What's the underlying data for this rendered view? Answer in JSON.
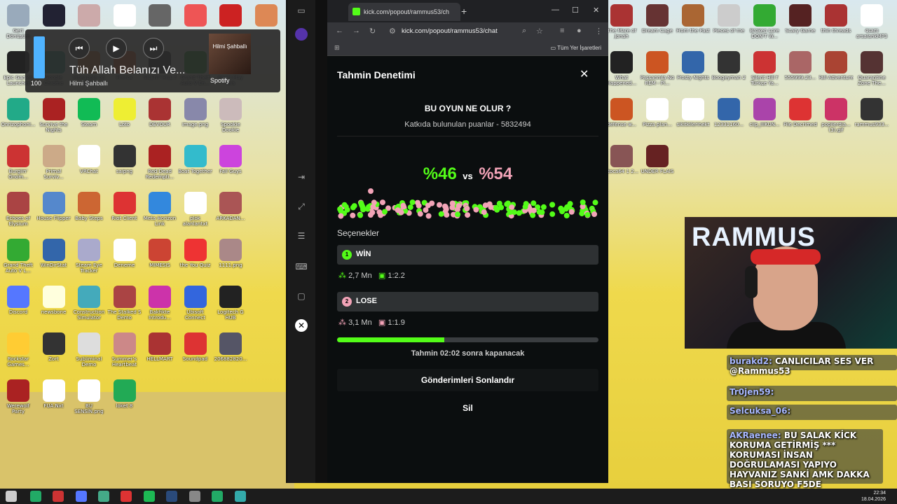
{
  "desktop": {
    "icons_left": [
      {
        "label": "Geri Dönüşüm",
        "color": "#9ab"
      },
      {
        "label": "",
        "color": "#223"
      },
      {
        "label": "",
        "color": "#caa"
      },
      {
        "label": "",
        "color": "#fff"
      },
      {
        "label": "",
        "color": "#666"
      },
      {
        "label": "",
        "color": "#e55"
      },
      {
        "label": "",
        "color": "#c22"
      },
      {
        "label": "",
        "color": "#d85"
      },
      {
        "label": "Epic Games Launcher",
        "color": "#222"
      },
      {
        "label": "Google Chrome",
        "color": "#4a8"
      },
      {
        "label": "Pineapple on pizza",
        "color": "#e84"
      },
      {
        "label": "Firefox",
        "color": "#f73"
      },
      {
        "label": "SILENT HILL f",
        "color": "#444"
      },
      {
        "label": "Grand Theft Auto V En...",
        "color": "#3a3"
      },
      {
        "label": "Don't Play this",
        "color": "#a63"
      },
      {
        "label": "Onrizophoni...",
        "color": "#2a8"
      },
      {
        "label": "Survive the Nights",
        "color": "#a22"
      },
      {
        "label": "Steam",
        "color": "#1b5"
      },
      {
        "label": "Loto",
        "color": "#ee3"
      },
      {
        "label": "DEVOUR",
        "color": "#a33"
      },
      {
        "label": "image.png",
        "color": "#88a"
      },
      {
        "label": "Spookie Dookie",
        "color": "#cbb"
      },
      {
        "label": "Burglin' Gnom...",
        "color": "#c33"
      },
      {
        "label": "Primal Surviv...",
        "color": "#ca8"
      },
      {
        "label": "VRChat",
        "color": "#fff"
      },
      {
        "label": "saipng",
        "color": "#333"
      },
      {
        "label": "Red Dead Redempti...",
        "color": "#a22"
      },
      {
        "label": "Boat Together",
        "color": "#3bc"
      },
      {
        "label": "Fall Guys",
        "color": "#c4d"
      },
      {
        "label": "Echoes of Elysium",
        "color": "#a44"
      },
      {
        "label": "House Flipper",
        "color": "#58c"
      },
      {
        "label": "Baby Steps",
        "color": "#c63"
      },
      {
        "label": "Riot Client",
        "color": "#d33"
      },
      {
        "label": "Meta Horizon Link",
        "color": "#38d"
      },
      {
        "label": "plok alanlarıtxt",
        "color": "#fff"
      },
      {
        "label": "ARKADAN...",
        "color": "#a55"
      },
      {
        "label": "Grand Theft Auto V L...",
        "color": "#3a3"
      },
      {
        "label": "WinDirStat",
        "color": "#36a"
      },
      {
        "label": "Steam Eye Tracker",
        "color": "#aac"
      },
      {
        "label": "Deneme",
        "color": "#fff"
      },
      {
        "label": "MIMESIS",
        "color": "#c43"
      },
      {
        "label": "the You Quiz",
        "color": "#e33"
      },
      {
        "label": "1111.png",
        "color": "#a88"
      },
      {
        "label": "Discord",
        "color": "#57f"
      },
      {
        "label": "newsbone",
        "color": "#ffd"
      },
      {
        "label": "Construction Simulator",
        "color": "#4ab"
      },
      {
        "label": "The Stalked S Demo",
        "color": "#a44"
      },
      {
        "label": "Bakfikte Introdu...",
        "color": "#c3a"
      },
      {
        "label": "Ubisoft Connect",
        "color": "#36d"
      },
      {
        "label": "Logitech G HUB",
        "color": "#222"
      },
      {
        "label": "Rockstar Games...",
        "color": "#fc3"
      },
      {
        "label": "Zort",
        "color": "#333"
      },
      {
        "label": "Subliminal Demo",
        "color": "#ddd"
      },
      {
        "label": "Summer's Heartbeat",
        "color": "#c88"
      },
      {
        "label": "HELLMART",
        "color": "#a33"
      },
      {
        "label": "Soundpad",
        "color": "#d33"
      },
      {
        "label": "206882820...",
        "color": "#556"
      },
      {
        "label": "Werewolf Party",
        "color": "#a22"
      },
      {
        "label": "FUA.Nxt",
        "color": "#fff"
      },
      {
        "label": "BU SENSİN.png",
        "color": "#fff"
      },
      {
        "label": "loket 8",
        "color": "#2a5"
      }
    ],
    "icons_right": [
      {
        "label": "The Mare of Jonah",
        "color": "#a33"
      },
      {
        "label": "Dream Cage",
        "color": "#633"
      },
      {
        "label": "From the Past",
        "color": "#a63"
      },
      {
        "label": "Pieces of me",
        "color": "#ccc"
      },
      {
        "label": "Broken Lore DON'T W...",
        "color": "#3a3"
      },
      {
        "label": "Scary Game",
        "color": "#522"
      },
      {
        "label": "thin threads",
        "color": "#a33"
      },
      {
        "label": "4sam arsalankMP3",
        "color": "#fff"
      },
      {
        "label": "What Happened...",
        "color": "#222"
      },
      {
        "label": "Passannıla No REM - Pl...",
        "color": "#c52"
      },
      {
        "label": "Frosty Nights",
        "color": "#36a"
      },
      {
        "label": "Boogeyman 2",
        "color": "#333"
      },
      {
        "label": "Silent Hill f Türkçe Ya...",
        "color": "#c33"
      },
      {
        "label": "555999.23...",
        "color": "#a66"
      },
      {
        "label": "Fall Adventure",
        "color": "#a43"
      },
      {
        "label": "Quarantine Zone The...",
        "color": "#533"
      },
      {
        "label": "defense w...",
        "color": "#c52"
      },
      {
        "label": "Pizza plan...",
        "color": "#fff"
      },
      {
        "label": "sikitkilerinekt",
        "color": "#fff"
      },
      {
        "label": "12331160...",
        "color": "#36a"
      },
      {
        "label": "clip_IIIKUN...",
        "color": "#a4a"
      },
      {
        "label": "File Decrimed",
        "color": "#d33"
      },
      {
        "label": "popilerdia... (3).gif",
        "color": "#c36"
      },
      {
        "label": "rammus933...",
        "color": "#333"
      },
      {
        "label": "Stoca64 1 2...",
        "color": "#855"
      },
      {
        "label": "UNDER FLAIS",
        "color": "#622"
      }
    ]
  },
  "media": {
    "volume": 100,
    "volume_label": "100",
    "title": "Tüh Allah Belanızı Ve...",
    "artist": "Hilmi Şahballı",
    "album_text": "Hilmi Şahballı",
    "source": "Spotify",
    "prev_icon": "skip-previous-icon",
    "play_icon": "play-icon",
    "next_icon": "skip-next-icon"
  },
  "browser": {
    "tab_title": "kick.com/popout/rammus53/ch",
    "url": "kick.com/popout/rammus53/chat",
    "bookmarks_label": "Tüm Yer İşaretleri"
  },
  "prediction": {
    "title": "Tahmin Denetimi",
    "question": "BU OYUN NE OLUR ?",
    "contributed": "Katkıda bulunulan puanlar - 5832494",
    "percent_a": "%46",
    "vs": "vs",
    "percent_b": "%54",
    "options_label": "Seçenekler",
    "options": [
      {
        "num": "1",
        "name": "WİN",
        "points": "2,7 Mn",
        "ratio": "1:2.2",
        "color": "#53fc18"
      },
      {
        "num": "2",
        "name": "LOSE",
        "points": "3,1 Mn",
        "ratio": "1:1.9",
        "color": "#f2a3b7"
      }
    ],
    "time_fraction": 0.41,
    "closes_text": "Tahmin 02:02 sonra kapanacak",
    "end_button": "Gönderimleri Sonlandır",
    "delete_button": "Sil"
  },
  "webcam": {
    "brand_text": "RAMMUS"
  },
  "chat": [
    {
      "user": "burakd2",
      "text": "CANLICILAR SES VER @Rammus53"
    },
    {
      "user": "Tr0jen59",
      "text": ""
    },
    {
      "user": "Selcuksa_06",
      "text": ""
    },
    {
      "user": "AKRaenee",
      "text": "BU SALAK KİCK KORUMA GETİRMİŞ *** KORUMASI İNSAN DOĞRULAMASI YAPIYO HAYVANIZ SANKİ AMK DAKKA BASI SORUYO F5DE"
    }
  ],
  "taskbar": {
    "time": "22:34",
    "date": "18.04.2026"
  }
}
